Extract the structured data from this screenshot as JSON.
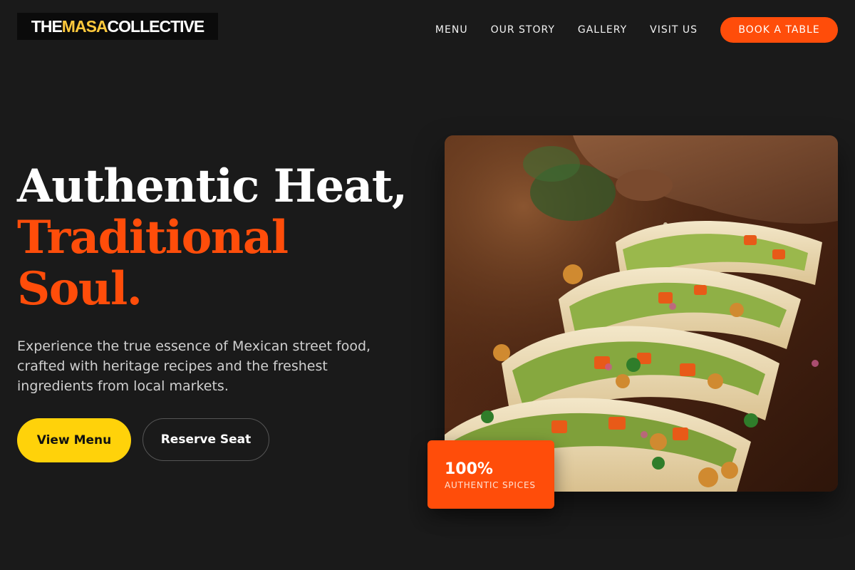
{
  "brand": {
    "logo_part1": "THE",
    "logo_part2": "MASA",
    "logo_part3": "COLLECTIVE"
  },
  "nav": {
    "items": [
      {
        "label": "MENU"
      },
      {
        "label": "OUR STORY"
      },
      {
        "label": "GALLERY"
      },
      {
        "label": "VISIT US"
      }
    ],
    "cta_label": "BOOK A TABLE"
  },
  "hero": {
    "headline_line1": "Authentic Heat,",
    "headline_line2": "Traditional",
    "headline_line3": "Soul.",
    "subtext": "Experience the true essence of Mexican street food, crafted with heritage recipes and the freshest ingredients from local markets.",
    "primary_button": "View Menu",
    "secondary_button": "Reserve Seat",
    "image_icon": "tacos-photo",
    "badge": {
      "value": "100%",
      "label": "AUTHENTIC SPICES"
    }
  },
  "colors": {
    "background": "#1a1a1a",
    "accent_orange": "#ff4d0a",
    "accent_yellow": "#ffd20a",
    "logo_yellow": "#ffc93c"
  }
}
